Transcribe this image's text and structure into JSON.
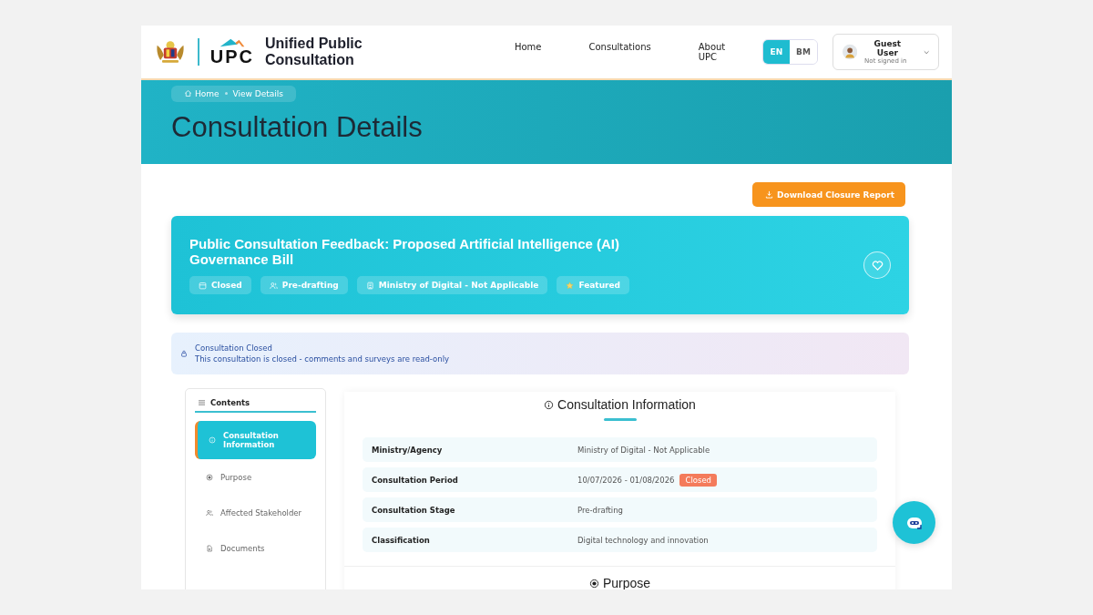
{
  "header": {
    "site_title": "Unified Public Consultation",
    "logo_text": "UPC",
    "nav": [
      {
        "label": "Home"
      },
      {
        "label": "Consultations"
      },
      {
        "label": "About UPC"
      }
    ],
    "languages": [
      {
        "label": "EN",
        "selected": true
      },
      {
        "label": "BM",
        "selected": false
      }
    ],
    "user": {
      "name": "Guest User",
      "status": "Not signed in"
    }
  },
  "breadcrumb": [
    {
      "label": "Home",
      "kind": "home"
    },
    {
      "label": "View Details",
      "kind": "page"
    }
  ],
  "page_title": "Consultation Details",
  "download_button": "Download Closure Report",
  "consultation": {
    "title": "Public Consultation Feedback: Proposed Artificial Intelligence (AI) Governance Bill",
    "tags": [
      {
        "label": "Closed",
        "kind": "calendar"
      },
      {
        "label": "Pre-drafting",
        "kind": "people"
      },
      {
        "label": "Ministry of Digital - Not Applicable",
        "kind": "building"
      },
      {
        "label": "Featured",
        "kind": "star"
      }
    ]
  },
  "alert": {
    "title": "Consultation Closed",
    "message": "This consultation is closed - comments and surveys are read-only"
  },
  "contents": {
    "title": "Contents",
    "items": [
      {
        "label": "Consultation Information",
        "kind": "info",
        "selected": true
      },
      {
        "label": "Purpose",
        "kind": "target",
        "selected": false
      },
      {
        "label": "Affected Stakeholder",
        "kind": "people",
        "selected": false
      },
      {
        "label": "Documents",
        "kind": "document",
        "selected": false
      }
    ]
  },
  "info_section": {
    "title": "Consultation Information",
    "rows": [
      {
        "label": "Ministry/Agency",
        "value": "Ministry of Digital - Not Applicable"
      },
      {
        "label": "Consultation Period",
        "value": "10/07/2026 - 01/08/2026",
        "badge": "Closed"
      },
      {
        "label": "Consultation Stage",
        "value": "Pre-drafting"
      },
      {
        "label": "Classification",
        "value": "Digital technology and innovation"
      }
    ]
  },
  "next_section": {
    "title": "Purpose"
  }
}
